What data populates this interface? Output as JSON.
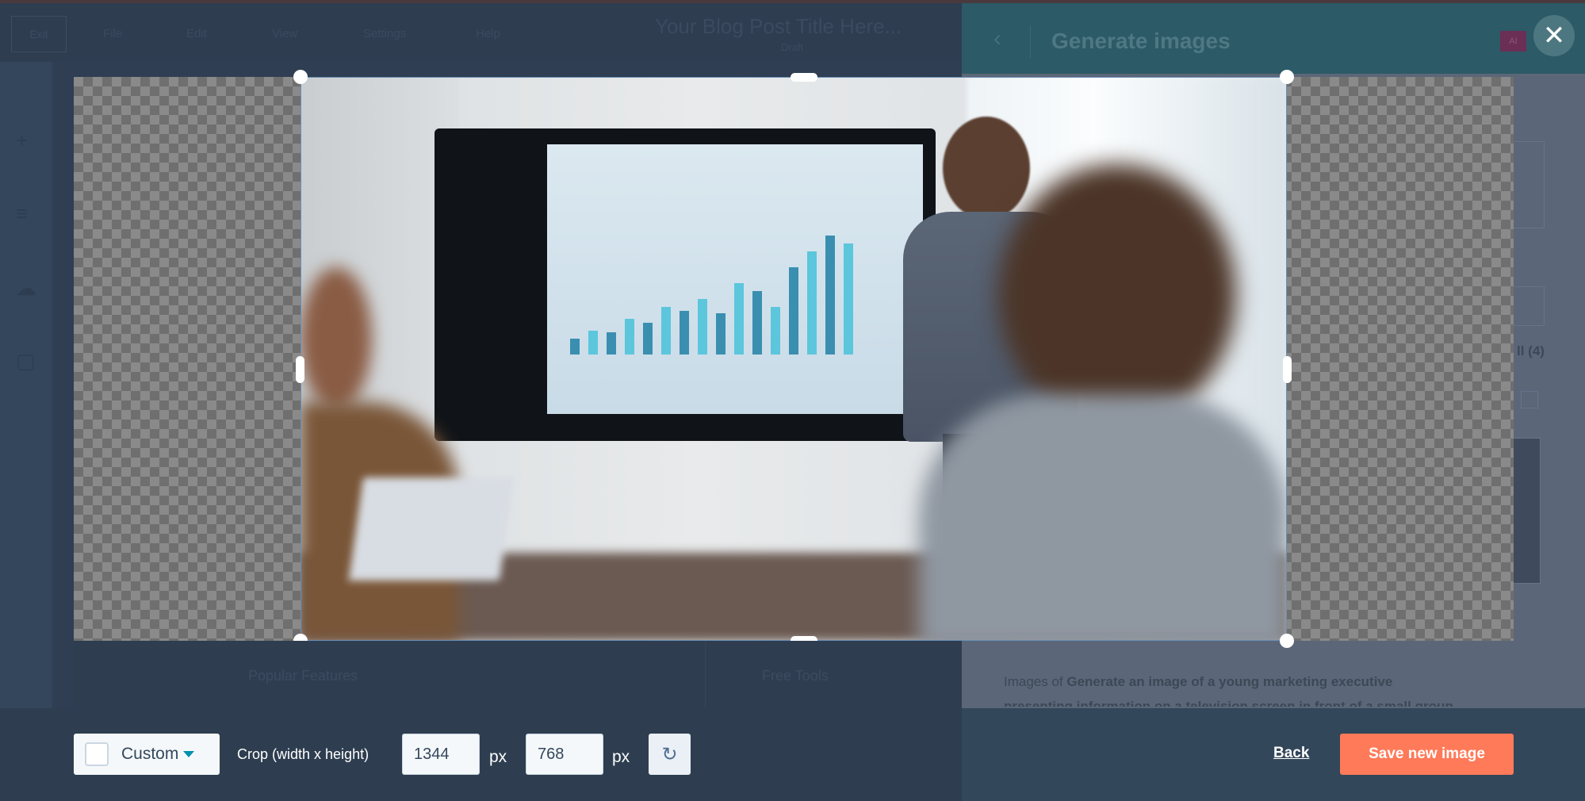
{
  "editor": {
    "logo_text": "Exit",
    "menu": [
      "File",
      "Edit",
      "View",
      "Settings",
      "Help"
    ],
    "post_title": "Your Blog Post Title Here...",
    "post_status": "Draft",
    "rail_icons": [
      "plus-icon",
      "layers-icon",
      "paint-icon",
      "document-icon"
    ],
    "footer_links": [
      "Popular Features",
      "Free Tools"
    ]
  },
  "panel": {
    "title": "Generate images",
    "ai_badge": "AI",
    "count_label": "ll (4)",
    "caption_prefix": "Images of ",
    "caption_prompt": "Generate an image of a young marketing executive",
    "caption_line2": "presenting information on a television screen in front of a small group"
  },
  "crop": {
    "aspect_select": "Custom",
    "dimensions_label": "Crop (width x height)",
    "width": "1344",
    "height": "768",
    "unit": "px"
  },
  "actions": {
    "back": "Back",
    "save": "Save new image"
  },
  "colors": {
    "primary_button": "#ff7a59",
    "overlay": "#2e3e50",
    "accent": "#0091ae"
  }
}
